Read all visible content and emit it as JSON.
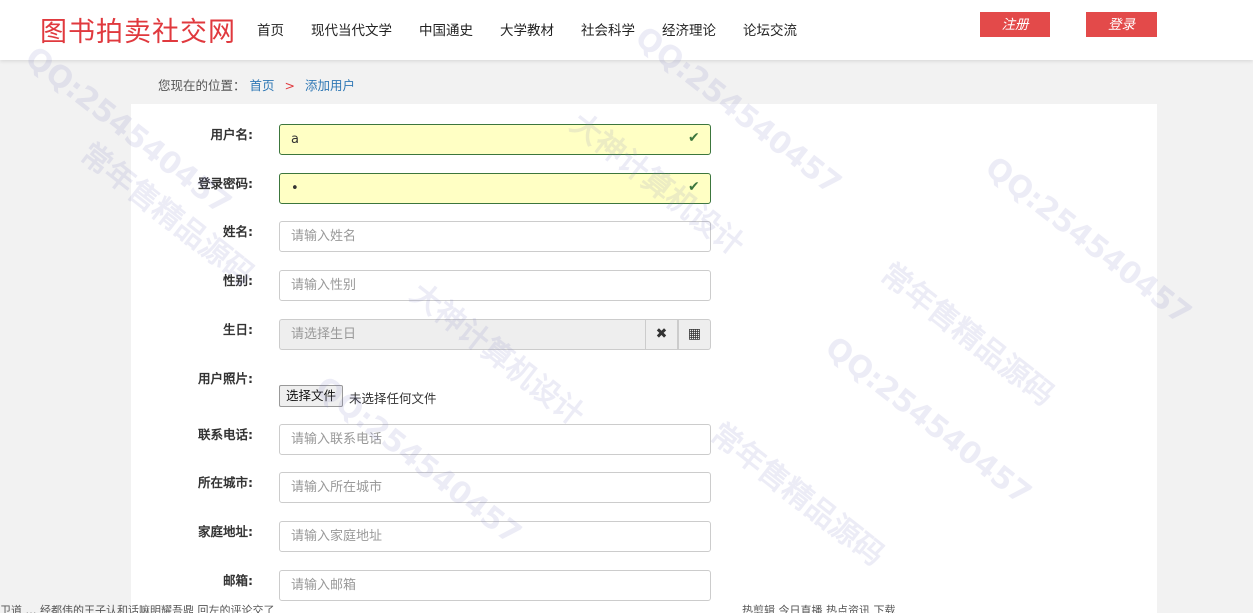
{
  "header": {
    "logo": "图书拍卖社交网",
    "nav": [
      "首页",
      "现代当代文学",
      "中国通史",
      "大学教材",
      "社会科学",
      "经济理论",
      "论坛交流"
    ],
    "register_label": "注册",
    "login_label": "登录"
  },
  "breadcrumb": {
    "prefix": "您现在的位置：",
    "home": "首页",
    "separator": ">",
    "current": "添加用户"
  },
  "form": {
    "username": {
      "label": "用户名:",
      "value": "a"
    },
    "password": {
      "label": "登录密码:",
      "value": "•"
    },
    "name": {
      "label": "姓名:",
      "placeholder": "请输入姓名"
    },
    "gender": {
      "label": "性别:",
      "placeholder": "请输入性别"
    },
    "birthday": {
      "label": "生日:",
      "placeholder": "请选择生日",
      "clear_icon": "✖",
      "calendar_icon": "▦"
    },
    "photo": {
      "label": "用户照片:",
      "button": "选择文件",
      "status": "未选择任何文件"
    },
    "phone": {
      "label": "联系电话:",
      "placeholder": "请输入联系电话"
    },
    "city": {
      "label": "所在城市:",
      "placeholder": "请输入所在城市"
    },
    "address": {
      "label": "家庭地址:",
      "placeholder": "请输入家庭地址"
    },
    "email": {
      "label": "邮箱:",
      "placeholder": "请输入邮箱"
    }
  },
  "watermark": {
    "qq": "QQ:254540457",
    "slogan1": "常年售精品源码",
    "slogan2": "大神计算机设计"
  },
  "statusbar": {
    "left": "卫道 … 经都伟的王子认和话嘛明耀吾鼎 回左的评论交了",
    "right": "热剪辑   今日直播   热点资讯   下载"
  },
  "colors": {
    "brand": "#e0393e",
    "button": "#e34a4a",
    "link": "#2f78b5",
    "valid": "#3c763d",
    "valid_bg": "#ffffc4"
  }
}
